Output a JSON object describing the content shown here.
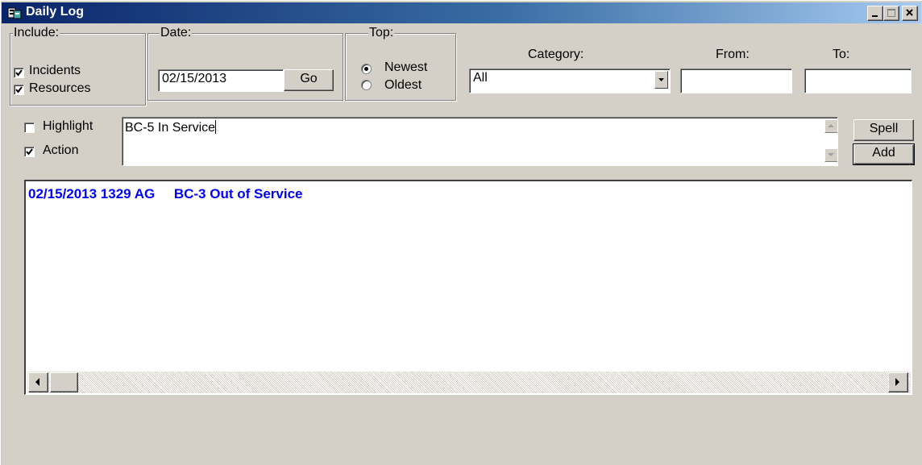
{
  "window": {
    "title": "Daily Log",
    "icon": "daily-log-app-icon",
    "controls": [
      "minimize-icon",
      "maximize-icon",
      "close-icon"
    ]
  },
  "include": {
    "legend": "Include:",
    "incidents_label": "Incidents",
    "incidents_checked": true,
    "resources_label": "Resources",
    "resources_checked": true
  },
  "date": {
    "legend": "Date:",
    "value": "02/15/2013",
    "go_label": "Go"
  },
  "top": {
    "legend": "Top:",
    "newest_label": "Newest",
    "oldest_label": "Oldest",
    "selected": "Newest"
  },
  "category": {
    "label": "Category:",
    "selected": "All"
  },
  "from": {
    "label": "From:",
    "value": ""
  },
  "to": {
    "label": "To:",
    "value": ""
  },
  "entry": {
    "highlight_label": "Highlight",
    "highlight_checked": false,
    "action_label": "Action",
    "action_checked": true,
    "text": "BC-5 In Service",
    "spell_label": "Spell",
    "add_label": "Add"
  },
  "log": {
    "entries": [
      {
        "text": "02/15/2013 1329 AG     BC-3 Out of Service",
        "color": "#0000ff"
      }
    ]
  },
  "colors": {
    "titlebar_start": "#0a246a",
    "titlebar_end": "#a6caf0",
    "face": "#d4d0c8",
    "log_text": "#0000ff"
  }
}
